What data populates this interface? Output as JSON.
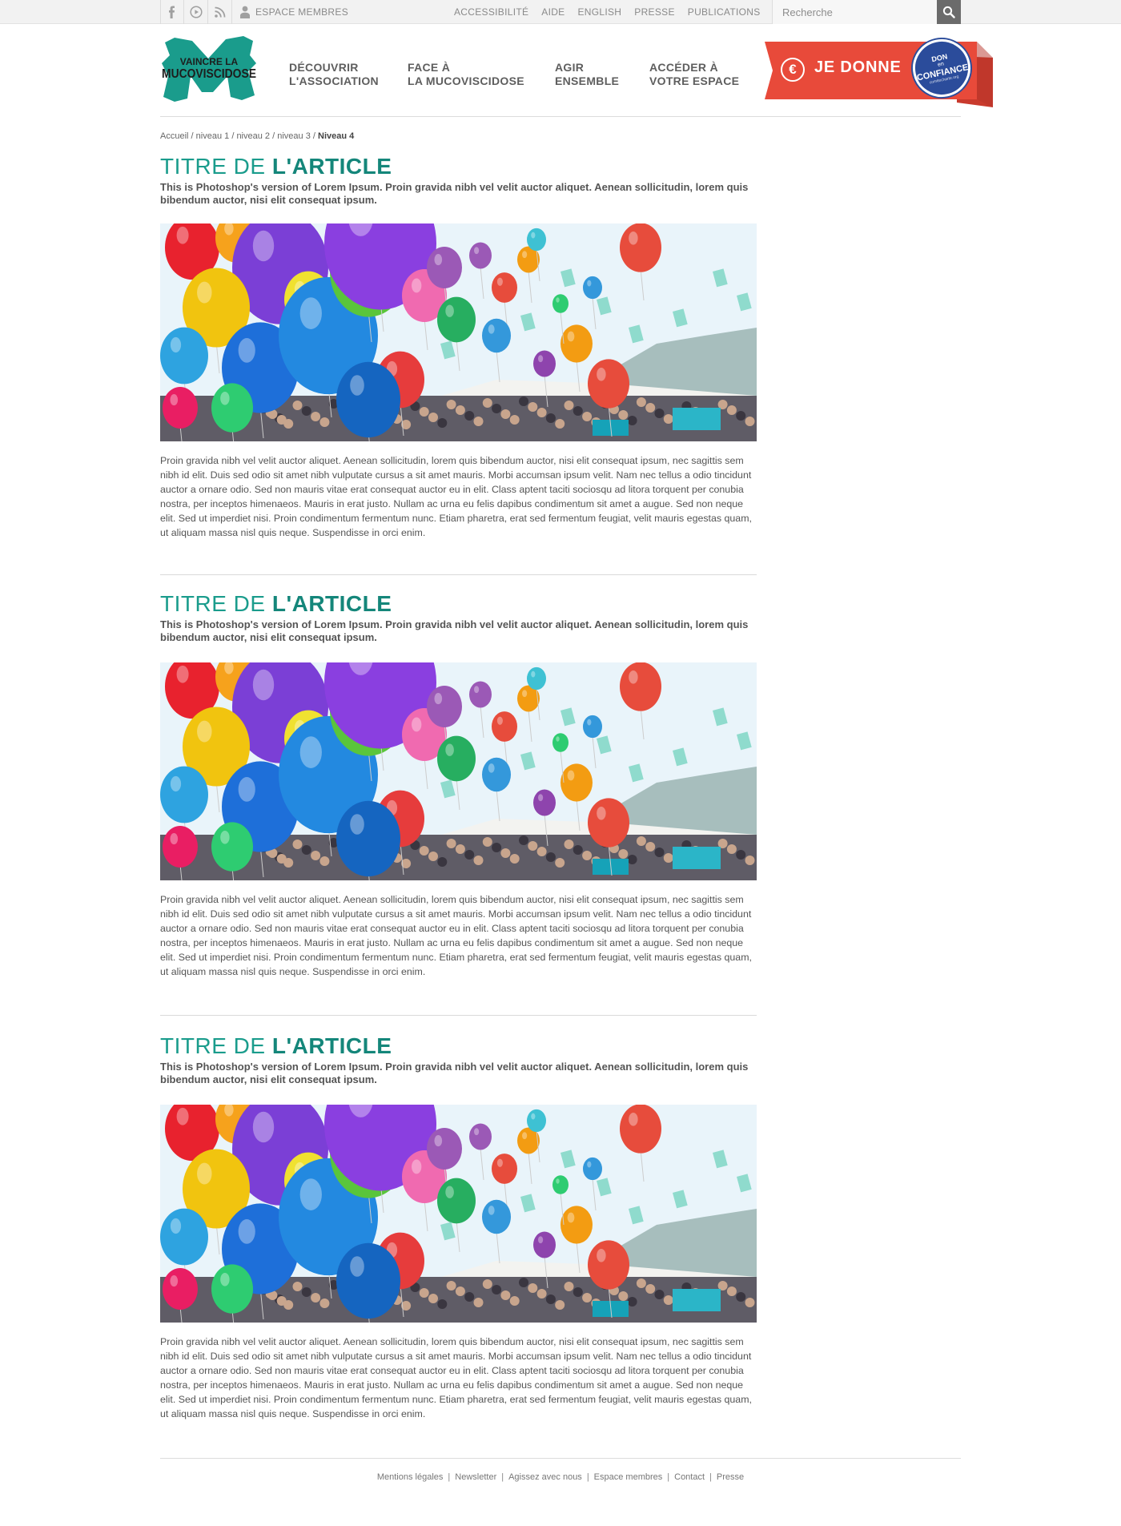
{
  "topbar": {
    "icons": [
      "facebook-icon",
      "youtube-icon",
      "rss-icon"
    ],
    "members_label": "ESPACE MEMBRES",
    "links": [
      "ACCESSIBILITÉ",
      "AIDE",
      "ENGLISH",
      "PRESSE",
      "PUBLICATIONS"
    ],
    "search_placeholder": "Recherche"
  },
  "logo": {
    "line1": "VAINCRE LA",
    "line2": "MUCOVISCIDOSE",
    "color": "#1a9c8c"
  },
  "nav": [
    {
      "line1": "DÉCOUVRIR",
      "line2": "L'ASSOCIATION"
    },
    {
      "line1": "FACE À",
      "line2": "LA MUCOVISCIDOSE"
    },
    {
      "line1": "AGIR",
      "line2": "ENSEMBLE"
    },
    {
      "line1": "ACCÉDER À",
      "line2": "VOTRE ESPACE"
    }
  ],
  "donate": {
    "euro_symbol": "€",
    "label": "JE DONNE",
    "seal": {
      "line1": "DON",
      "line2": "en",
      "line3": "CONFIANCE",
      "line4": "comitecharte.org"
    },
    "color": "#e84a3a"
  },
  "breadcrumb": {
    "items": [
      "Accueil",
      "niveau 1",
      "niveau 2",
      "niveau 3"
    ],
    "current": "Niveau 4",
    "separator": "/"
  },
  "articles": [
    {
      "title_part1": "TITRE DE ",
      "title_part2": "L'ARTICLE",
      "lead": "This is Photoshop's version  of Lorem Ipsum. Proin gravida nibh vel velit auctor aliquet. Aenean sollicitudin, lorem quis bibendum auctor, nisi elit consequat ipsum.",
      "body": "Proin gravida nibh vel velit auctor aliquet. Aenean sollicitudin, lorem quis bibendum auctor, nisi elit consequat ipsum, nec sagittis sem nibh id elit. Duis sed odio sit amet nibh vulputate cursus a sit amet mauris. Morbi accumsan ipsum velit. Nam nec tellus a odio tincidunt auctor a ornare odio. Sed non  mauris vitae erat consequat auctor eu in elit. Class aptent taciti sociosqu ad litora torquent per conubia nostra, per inceptos himenaeos. Mauris in erat justo. Nullam ac urna eu felis dapibus condimentum sit amet a augue. Sed non neque elit. Sed ut imperdiet nisi. Proin condimentum fermentum nunc. Etiam pharetra, erat sed fermentum feugiat, velit mauris egestas quam, ut aliquam massa nisl quis neque. Suspendisse in orci enim."
    },
    {
      "title_part1": "TITRE DE ",
      "title_part2": "L'ARTICLE",
      "lead": "This is Photoshop's version  of Lorem Ipsum. Proin gravida nibh vel velit auctor aliquet. Aenean sollicitudin, lorem quis bibendum auctor, nisi elit consequat ipsum.",
      "body": "Proin gravida nibh vel velit auctor aliquet. Aenean sollicitudin, lorem quis bibendum auctor, nisi elit consequat ipsum, nec sagittis sem nibh id elit. Duis sed odio sit amet nibh vulputate cursus a sit amet mauris. Morbi accumsan ipsum velit. Nam nec tellus a odio tincidunt auctor a ornare odio. Sed non  mauris vitae erat consequat auctor eu in elit. Class aptent taciti sociosqu ad litora torquent per conubia nostra, per inceptos himenaeos. Mauris in erat justo. Nullam ac urna eu felis dapibus condimentum sit amet a augue. Sed non neque elit. Sed ut imperdiet nisi. Proin condimentum fermentum nunc. Etiam pharetra, erat sed fermentum feugiat, velit mauris egestas quam, ut aliquam massa nisl quis neque. Suspendisse in orci enim."
    },
    {
      "title_part1": "TITRE DE ",
      "title_part2": "L'ARTICLE",
      "lead": "This is Photoshop's version  of Lorem Ipsum. Proin gravida nibh vel velit auctor aliquet. Aenean sollicitudin, lorem quis bibendum auctor, nisi elit consequat ipsum.",
      "body": "Proin gravida nibh vel velit auctor aliquet. Aenean sollicitudin, lorem quis bibendum auctor, nisi elit consequat ipsum, nec sagittis sem nibh id elit. Duis sed odio sit amet nibh vulputate cursus a sit amet mauris. Morbi accumsan ipsum velit. Nam nec tellus a odio tincidunt auctor a ornare odio. Sed non  mauris vitae erat consequat auctor eu in elit. Class aptent taciti sociosqu ad litora torquent per conubia nostra, per inceptos himenaeos. Mauris in erat justo. Nullam ac urna eu felis dapibus condimentum sit amet a augue. Sed non neque elit. Sed ut imperdiet nisi. Proin condimentum fermentum nunc. Etiam pharetra, erat sed fermentum feugiat, velit mauris egestas quam, ut aliquam massa nisl quis neque. Suspendisse in orci enim."
    }
  ],
  "footer": {
    "links": [
      "Mentions légales",
      "Newsletter",
      "Agissez avec nous",
      "Espace membres",
      "Contact",
      "Presse"
    ],
    "separator": "|"
  },
  "colors": {
    "accent": "#1a9c8c",
    "donate_red": "#e84a3a",
    "seal_blue": "#2b4c9b",
    "search_button": "#6b6b6b"
  }
}
